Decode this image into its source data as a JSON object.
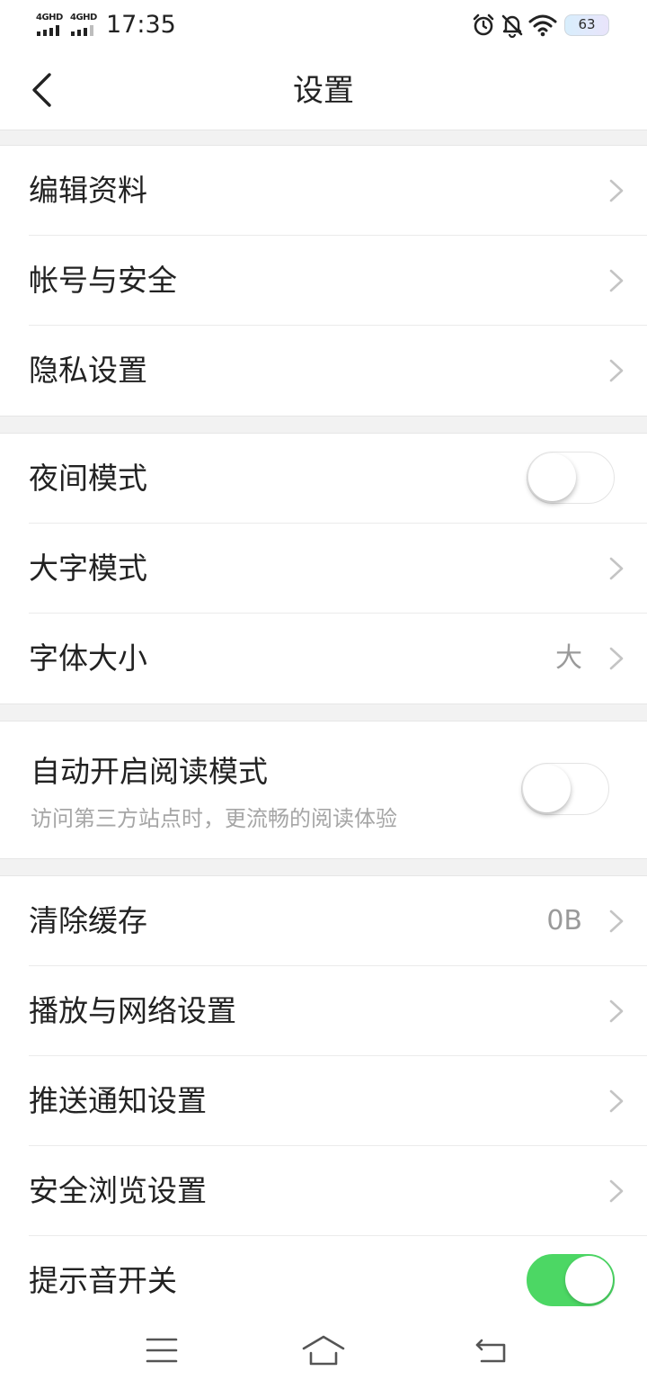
{
  "status_bar": {
    "network_1": "4GHD",
    "network_2": "4GHD",
    "time": "17:35",
    "battery": "63"
  },
  "header": {
    "title": "设置"
  },
  "sections": {
    "account": {
      "edit_profile": "编辑资料",
      "account_security": "帐号与安全",
      "privacy": "隐私设置"
    },
    "display": {
      "night_mode": "夜间模式",
      "night_mode_on": false,
      "large_text_mode": "大字模式",
      "font_size": "字体大小",
      "font_size_value": "大"
    },
    "reading": {
      "auto_reading_mode": "自动开启阅读模式",
      "auto_reading_desc": "访问第三方站点时，更流畅的阅读体验",
      "auto_reading_on": false
    },
    "general": {
      "clear_cache": "清除缓存",
      "cache_size": "0B",
      "playback_network": "播放与网络设置",
      "push_notification": "推送通知设置",
      "safe_browsing": "安全浏览设置",
      "sound_switch": "提示音开关",
      "sound_on": true
    }
  },
  "colors": {
    "switch_on": "#4cd764",
    "section_gap": "#f2f2f2",
    "secondary_text": "#a6a6a6"
  },
  "icons": {
    "back": "chevron-left-icon",
    "row_arrow": "chevron-right-icon",
    "alarm": "alarm-clock-icon",
    "mute": "bell-off-icon",
    "wifi": "wifi-icon",
    "menu": "hamburger-menu-icon",
    "home": "home-icon",
    "nav_back": "return-icon"
  }
}
